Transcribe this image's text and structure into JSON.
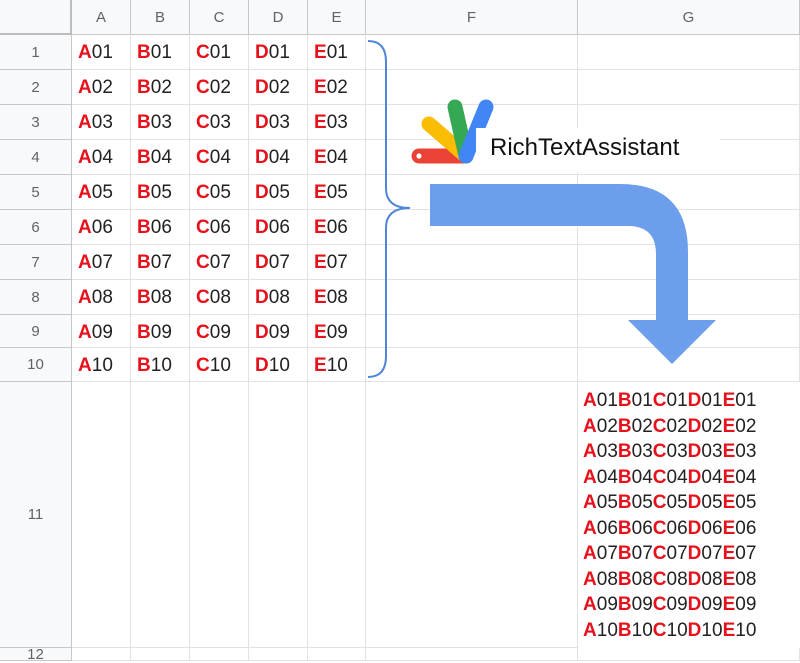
{
  "columns": [
    "A",
    "B",
    "C",
    "D",
    "E",
    "F",
    "G"
  ],
  "rows": [
    "1",
    "2",
    "3",
    "4",
    "5",
    "6",
    "7",
    "8",
    "9",
    "10",
    "11",
    "12"
  ],
  "grid_rows": [
    [
      "A01",
      "B01",
      "C01",
      "D01",
      "E01"
    ],
    [
      "A02",
      "B02",
      "C02",
      "D02",
      "E02"
    ],
    [
      "A03",
      "B03",
      "C03",
      "D03",
      "E03"
    ],
    [
      "A04",
      "B04",
      "C04",
      "D04",
      "E04"
    ],
    [
      "A05",
      "B05",
      "C05",
      "D05",
      "E05"
    ],
    [
      "A06",
      "B06",
      "C06",
      "D06",
      "E06"
    ],
    [
      "A07",
      "B07",
      "C07",
      "D07",
      "E07"
    ],
    [
      "A08",
      "B08",
      "C08",
      "D08",
      "E08"
    ],
    [
      "A09",
      "B09",
      "C09",
      "D09",
      "E09"
    ],
    [
      "A10",
      "B10",
      "C10",
      "D10",
      "E10"
    ]
  ],
  "merged_cell_G11": [
    "A01B01C01D01E01",
    "A02B02C02D02E02",
    "A03B03C03D03E03",
    "A04B04C04D04E04",
    "A05B05C05D05E05",
    "A06B06C06D06E06",
    "A07B07C07D07E07",
    "A08B08C08D08E08",
    "A09B09C09D09E09",
    "A10B10C10D10E10"
  ],
  "addon": {
    "label": "RichTextAssistant",
    "icon": "google-apps-script-logo"
  },
  "colors": {
    "highlight_letter": "#e8101a",
    "arrow": "#6d9eeb",
    "brace": "#4f86d9",
    "header_bg": "#f8f9fa",
    "gridline": "#e2e2e2",
    "logo_red": "#ea4335",
    "logo_yellow": "#fbbc04",
    "logo_green": "#34a853",
    "logo_blue": "#4285f4"
  }
}
